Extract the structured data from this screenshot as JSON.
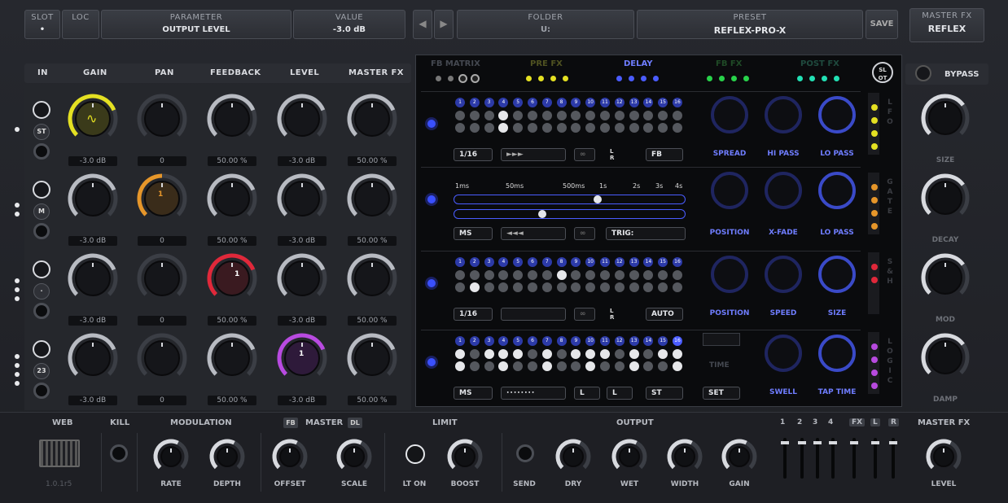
{
  "header": {
    "slot_label": "SLOT",
    "slot_value": "•",
    "loc_label": "LOC",
    "parameter_label": "PARAMETER",
    "parameter_value": "OUTPUT LEVEL",
    "value_label": "VALUE",
    "value_value": "-3.0 dB",
    "folder_label": "FOLDER",
    "folder_value": "U:",
    "preset_label": "PRESET",
    "preset_value": "REFLEX-PRO-X",
    "save_label": "SAVE",
    "masterfx_label": "MASTER FX",
    "masterfx_value": "REFLEX"
  },
  "columns": {
    "in": "IN",
    "gain": "GAIN",
    "pan": "PAN",
    "feedback": "FEEDBACK",
    "level": "LEVEL",
    "masterfx": "MASTER FX"
  },
  "rows": [
    {
      "tag": "ST",
      "gain": "-3.0 dB",
      "pan": "0",
      "feedback": "50.00 %",
      "level": "-3.0 dB",
      "masterfx": "50.00 %"
    },
    {
      "tag": "M",
      "gain": "-3.0 dB",
      "pan": "0",
      "feedback": "50.00 %",
      "level": "-3.0 dB",
      "masterfx": "50.00 %"
    },
    {
      "tag": "·",
      "gain": "-3.0 dB",
      "pan": "0",
      "feedback": "50.00 %",
      "level": "-3.0 dB",
      "masterfx": "50.00 %"
    },
    {
      "tag": "23",
      "gain": "-3.0 dB",
      "pan": "0",
      "feedback": "50.00 %",
      "level": "-3.0 dB",
      "masterfx": "50.00 %"
    }
  ],
  "badges": {
    "pan_row2": "1",
    "feedback_row3": "1",
    "level_row4": "1"
  },
  "tabs": [
    "FB MATRIX",
    "PRE FX",
    "DELAY",
    "FB FX",
    "POST FX"
  ],
  "slot_badge": "SL OT",
  "steps": [
    "1",
    "2",
    "3",
    "4",
    "5",
    "6",
    "7",
    "8",
    "9",
    "10",
    "11",
    "12",
    "13",
    "14",
    "15",
    "16"
  ],
  "time_scale": [
    "1ms",
    "50ms",
    "500ms",
    "1s",
    "2s",
    "3s",
    "4s"
  ],
  "lanes": [
    {
      "sel1": "1/16",
      "sel2": "►►►",
      "lr": "L R",
      "extra": "FB",
      "knobs": [
        "SPREAD",
        "HI PASS",
        "LO PASS"
      ]
    },
    {
      "sel1": "MS",
      "sel2": "◄◄◄",
      "extra": "TRIG:",
      "knobs": [
        "POSITION",
        "X-FADE",
        "LO PASS"
      ]
    },
    {
      "sel1": "1/16",
      "lr": "L R",
      "extra": "AUTO",
      "knobs": [
        "POSITION",
        "SPEED",
        "SIZE"
      ]
    },
    {
      "sel1": "MS",
      "l1": "L",
      "l2": "L",
      "st": "ST",
      "time": "TIME",
      "set": "SET",
      "knobs": [
        "SWELL",
        "TAP TIME"
      ]
    }
  ],
  "side_labels": [
    "L F O",
    "G A T E",
    "S & H",
    "L O G I C"
  ],
  "right": {
    "bypass": "BYPASS",
    "knobs": [
      "SIZE",
      "DECAY",
      "MOD",
      "DAMP"
    ]
  },
  "footer": {
    "web": "WEB",
    "kill": "KILL",
    "modulation": "MODULATION",
    "fb": "FB",
    "master": "MASTER",
    "dl": "DL",
    "limit": "LIMIT",
    "output": "OUTPUT",
    "masterfx": "MASTER FX",
    "version": "1.0.1r5",
    "rate": "RATE",
    "depth": "DEPTH",
    "offset": "OFFSET",
    "scale": "SCALE",
    "lton": "LT ON",
    "boost": "BOOST",
    "send": "SEND",
    "dry": "DRY",
    "wet": "WET",
    "width": "WIDTH",
    "gain": "GAIN",
    "level": "LEVEL",
    "ch": [
      "1",
      "2",
      "3",
      "4"
    ],
    "fx": "FX",
    "l": "L",
    "r": "R"
  },
  "colors": {
    "accent_blue": "#4a5cff",
    "yellow": "#e4e022",
    "green": "#28d24a",
    "teal": "#22e0b4",
    "orange": "#e6962a",
    "red": "#e0283a",
    "purple": "#b84ae0"
  }
}
